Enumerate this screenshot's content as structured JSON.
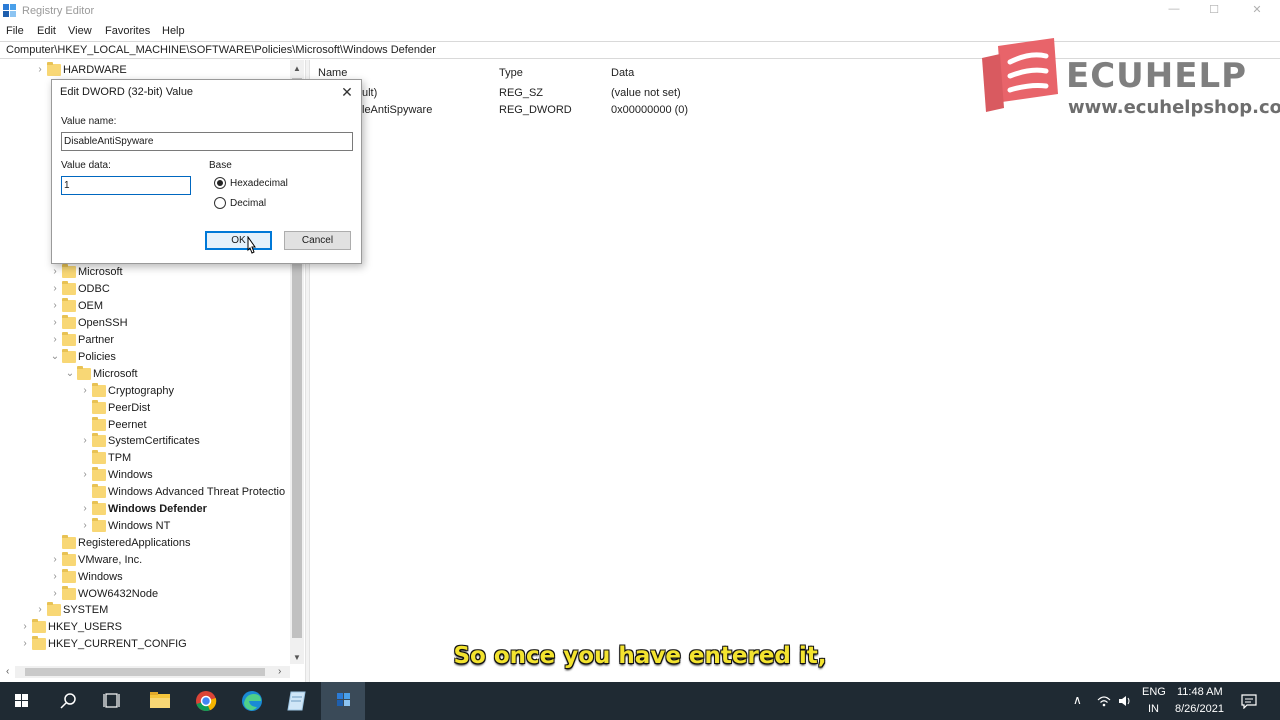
{
  "window": {
    "title": "Registry Editor",
    "controls": {
      "minimize": "—",
      "maximize": "☐",
      "close": "✕"
    }
  },
  "menu": [
    "File",
    "Edit",
    "View",
    "Favorites",
    "Help"
  ],
  "address": "Computer\\HKEY_LOCAL_MACHINE\\SOFTWARE\\Policies\\Microsoft\\Windows Defender",
  "tree": [
    {
      "label": "HARDWARE",
      "level": 1,
      "chevron": "right"
    },
    {
      "label": "Microsoft",
      "level": 2,
      "chevron": "right"
    },
    {
      "label": "ODBC",
      "level": 2,
      "chevron": "right"
    },
    {
      "label": "OEM",
      "level": 2,
      "chevron": "right"
    },
    {
      "label": "OpenSSH",
      "level": 2,
      "chevron": "right"
    },
    {
      "label": "Partner",
      "level": 2,
      "chevron": "right"
    },
    {
      "label": "Policies",
      "level": 2,
      "chevron": "down"
    },
    {
      "label": "Microsoft",
      "level": 3,
      "chevron": "down"
    },
    {
      "label": "Cryptography",
      "level": 4,
      "chevron": "right"
    },
    {
      "label": "PeerDist",
      "level": 4,
      "chevron": "none"
    },
    {
      "label": "Peernet",
      "level": 4,
      "chevron": "none"
    },
    {
      "label": "SystemCertificates",
      "level": 4,
      "chevron": "right"
    },
    {
      "label": "TPM",
      "level": 4,
      "chevron": "none"
    },
    {
      "label": "Windows",
      "level": 4,
      "chevron": "right"
    },
    {
      "label": "Windows Advanced Threat Protectio",
      "level": 4,
      "chevron": "none"
    },
    {
      "label": "Windows Defender",
      "level": 4,
      "chevron": "right",
      "selected": true
    },
    {
      "label": "Windows NT",
      "level": 4,
      "chevron": "right"
    },
    {
      "label": "RegisteredApplications",
      "level": 2,
      "chevron": "none"
    },
    {
      "label": "VMware, Inc.",
      "level": 2,
      "chevron": "right"
    },
    {
      "label": "Windows",
      "level": 2,
      "chevron": "right"
    },
    {
      "label": "WOW6432Node",
      "level": 2,
      "chevron": "right"
    },
    {
      "label": "SYSTEM",
      "level": 1,
      "chevron": "right"
    },
    {
      "label": "HKEY_USERS",
      "level": 0,
      "chevron": "right"
    },
    {
      "label": "HKEY_CURRENT_CONFIG",
      "level": 0,
      "chevron": "right"
    }
  ],
  "list": {
    "columns": [
      "Name",
      "Type",
      "Data"
    ],
    "rows": [
      {
        "name": "ult)",
        "type": "REG_SZ",
        "data": "(value not set)"
      },
      {
        "name": "leAntiSpyware",
        "type": "REG_DWORD",
        "data": "0x00000000 (0)"
      }
    ]
  },
  "watermark": {
    "brand": "ECUHELP",
    "url": "www.ecuhelpshop.com",
    "color": "#e8646a"
  },
  "dialog": {
    "title": "Edit DWORD (32-bit) Value",
    "value_name_label": "Value name:",
    "value_name": "DisableAntiSpyware",
    "value_data_label": "Value data:",
    "value_data": "1",
    "base_label": "Base",
    "base_options": [
      {
        "label": "Hexadecimal",
        "checked": true
      },
      {
        "label": "Decimal",
        "checked": false
      }
    ],
    "ok_label": "OK",
    "cancel_label": "Cancel"
  },
  "subtitle": "So once you have entered it,",
  "taskbar": {
    "language": "ENG",
    "region": "IN",
    "time": "11:48 AM",
    "date": "8/26/2021",
    "accent": "#7ab8ea"
  }
}
